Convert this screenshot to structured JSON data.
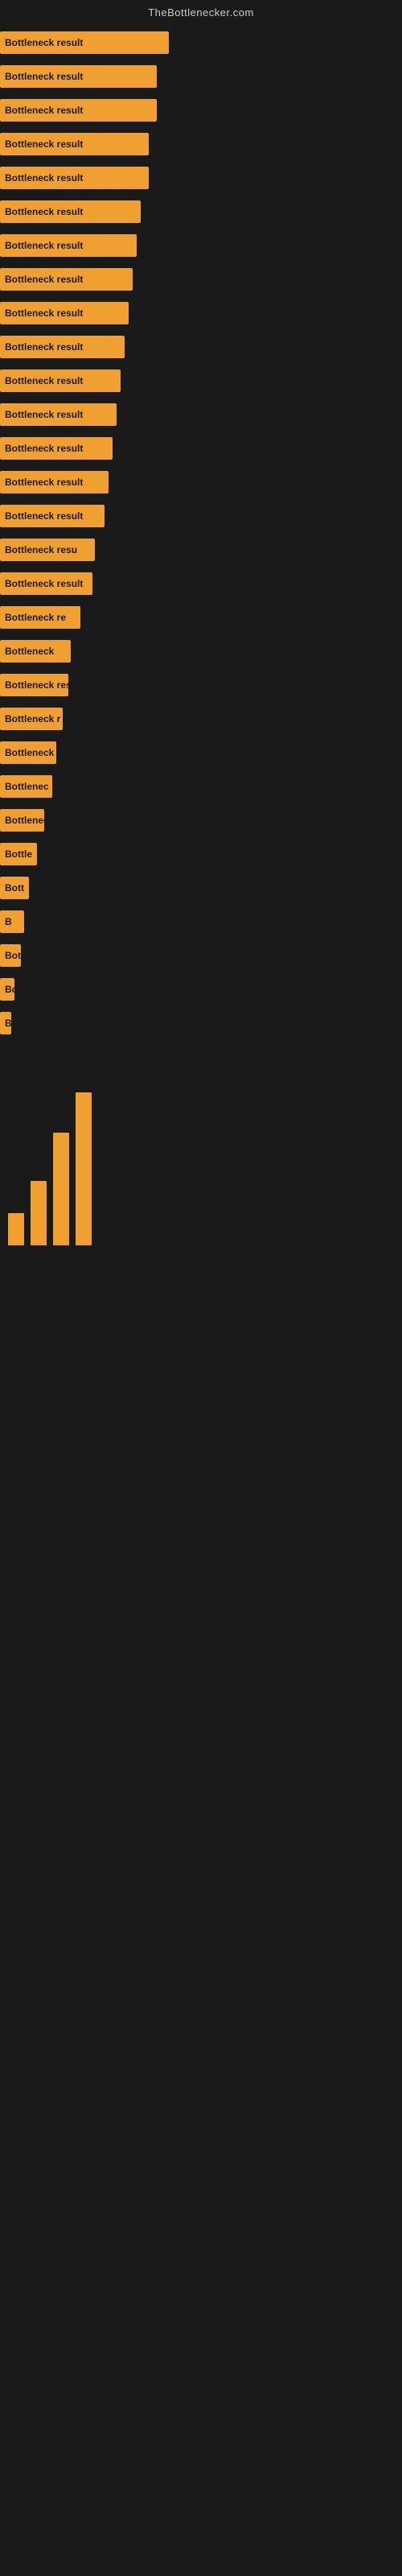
{
  "header": {
    "title": "TheBottlenecker.com"
  },
  "bars": [
    {
      "id": 1,
      "label": "Bottleneck result",
      "width_class": "bar-1"
    },
    {
      "id": 2,
      "label": "Bottleneck result",
      "width_class": "bar-2"
    },
    {
      "id": 3,
      "label": "Bottleneck result",
      "width_class": "bar-3"
    },
    {
      "id": 4,
      "label": "Bottleneck result",
      "width_class": "bar-4"
    },
    {
      "id": 5,
      "label": "Bottleneck result",
      "width_class": "bar-5"
    },
    {
      "id": 6,
      "label": "Bottleneck result",
      "width_class": "bar-6"
    },
    {
      "id": 7,
      "label": "Bottleneck result",
      "width_class": "bar-7"
    },
    {
      "id": 8,
      "label": "Bottleneck result",
      "width_class": "bar-8"
    },
    {
      "id": 9,
      "label": "Bottleneck result",
      "width_class": "bar-9"
    },
    {
      "id": 10,
      "label": "Bottleneck result",
      "width_class": "bar-10"
    },
    {
      "id": 11,
      "label": "Bottleneck result",
      "width_class": "bar-11"
    },
    {
      "id": 12,
      "label": "Bottleneck result",
      "width_class": "bar-12"
    },
    {
      "id": 13,
      "label": "Bottleneck result",
      "width_class": "bar-13"
    },
    {
      "id": 14,
      "label": "Bottleneck result",
      "width_class": "bar-14"
    },
    {
      "id": 15,
      "label": "Bottleneck result",
      "width_class": "bar-15"
    },
    {
      "id": 16,
      "label": "Bottleneck resu",
      "width_class": "bar-16"
    },
    {
      "id": 17,
      "label": "Bottleneck result",
      "width_class": "bar-17"
    },
    {
      "id": 18,
      "label": "Bottleneck re",
      "width_class": "bar-18"
    },
    {
      "id": 19,
      "label": "Bottleneck",
      "width_class": "bar-19"
    },
    {
      "id": 20,
      "label": "Bottleneck res",
      "width_class": "bar-20"
    },
    {
      "id": 21,
      "label": "Bottleneck r",
      "width_class": "bar-21"
    },
    {
      "id": 22,
      "label": "Bottleneck resu",
      "width_class": "bar-22"
    },
    {
      "id": 23,
      "label": "Bottlenec",
      "width_class": "bar-23"
    },
    {
      "id": 24,
      "label": "Bottleneck re",
      "width_class": "bar-24"
    },
    {
      "id": 25,
      "label": "Bottle",
      "width_class": "bar-25"
    },
    {
      "id": 26,
      "label": "Bott",
      "width_class": "bar-26"
    },
    {
      "id": 27,
      "label": "B",
      "width_class": "bar-27"
    },
    {
      "id": 28,
      "label": "Bot",
      "width_class": "bar-28"
    },
    {
      "id": 29,
      "label": "Bottlen",
      "width_class": "bar-29"
    },
    {
      "id": 30,
      "label": "B",
      "width_class": "bar-30"
    }
  ],
  "colors": {
    "bar_fill": "#f0a030",
    "background": "#1a1a1a",
    "header_text": "#cccccc",
    "bar_label": "#1a1a1a"
  }
}
